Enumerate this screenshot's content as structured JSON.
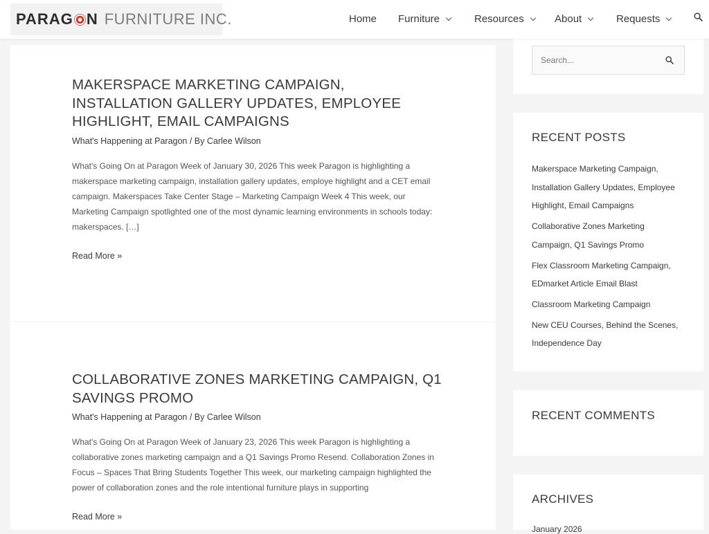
{
  "brand": {
    "strong_pre": "PARAG",
    "strong_post": "N",
    "light": "FURNITURE INC."
  },
  "nav": {
    "home": "Home",
    "furniture": "Furniture",
    "resources": "Resources",
    "about": "About",
    "requests": "Requests"
  },
  "posts": [
    {
      "title": "MAKERSPACE MARKETING CAMPAIGN, INSTALLATION GALLERY UPDATES, EMPLOYEE HIGHLIGHT, EMAIL CAMPAIGNS",
      "meta": "What's Happening at Paragon / By Carlee Wilson",
      "excerpt": "What's Going On at Paragon Week of January 30, 2026 This week Paragon is highlighting a makerspace marketing campaign, installation gallery updates, employe highlight and a CET email campaign. Makerspaces Take Center Stage – Marketing Campaign Week 4 This week, our Marketing Campaign spotlighted one of the most dynamic learning environments in schools today: makerspaces. […]",
      "read_more": "Read More »"
    },
    {
      "title": "COLLABORATIVE ZONES MARKETING CAMPAIGN, Q1 SAVINGS PROMO",
      "meta": "What's Happening at Paragon / By Carlee Wilson",
      "excerpt": "What's Going On at Paragon Week of January 23, 2026 This week Paragon is highlighting a collaborative zones marketing campaign and a Q1 Savings Promo Resend. Collaboration Zones in Focus – Spaces That Bring Students Together This week, our marketing campaign highlighted the power of collaboration zones and the role intentional furniture plays in supporting",
      "read_more": "Read More »"
    }
  ],
  "sidebar": {
    "search_placeholder": "Search...",
    "recent_posts_title": "RECENT POSTS",
    "recent_posts": [
      "Makerspace Marketing Campaign, Installation Gallery Updates, Employee Highlight, Email Campaigns",
      "Collaborative Zones Marketing Campaign, Q1 Savings Promo",
      "Flex Classroom Marketing Campaign, EDmarket Article Email Blast",
      "Classroom Marketing Campaign",
      "New CEU Courses, Behind the Scenes, Independence Day"
    ],
    "recent_comments_title": "RECENT COMMENTS",
    "archives_title": "ARCHIVES",
    "archives": [
      "January 2026"
    ]
  },
  "colors": {
    "accent": "#d33a2c",
    "text": "#3a3a3a",
    "background": "#f4f4f4"
  },
  "icons": [
    "search-icon",
    "chevron-down-icon",
    "target-logo-icon"
  ]
}
